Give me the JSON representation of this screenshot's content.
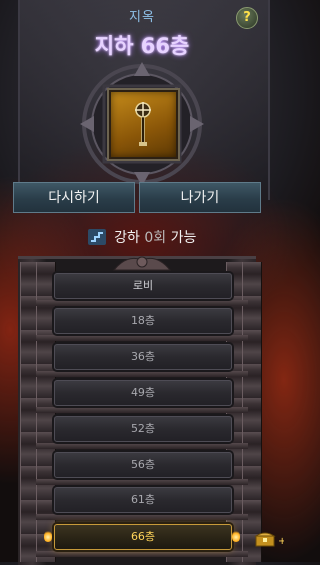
{
  "header": {
    "region": "지옥",
    "floor_title": "지하 66층",
    "help_label": "?"
  },
  "actions": {
    "retry_label": "다시하기",
    "exit_label": "나가기"
  },
  "enhance": {
    "prefix": "강하",
    "count": "0회",
    "suffix": "가능"
  },
  "tower": {
    "floors": [
      "로비",
      "18층",
      "36층",
      "49층",
      "52층",
      "56층",
      "61층",
      "66층"
    ],
    "current_index": 7
  },
  "colors": {
    "title_glow": "#b27cff",
    "button": "#2a3d49",
    "current_floor": "#ffd45a",
    "slot_item": "#c48a1a"
  },
  "icons": [
    "help-icon",
    "mace-item-icon",
    "stairs-icon",
    "treasure-chest-icon",
    "torch-icon"
  ]
}
